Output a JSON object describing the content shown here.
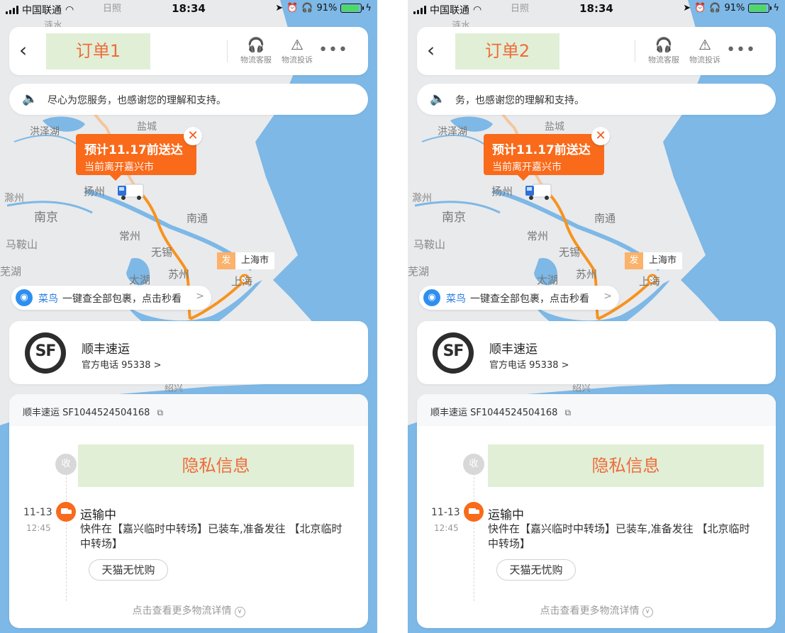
{
  "status_bar": {
    "carrier": "中国联通",
    "time": "18:34",
    "battery": "91%",
    "battery_level": 0.91
  },
  "colors": {
    "accent": "#f96a1a",
    "route": "#f7931e",
    "water": "#7db8e6",
    "land": "#e9eaec",
    "highlight_box": "#e1efd7"
  },
  "map_labels": {
    "rizhao": "日照",
    "lianshui": "涟水",
    "yancheng": "盐城",
    "hongzehu": "洪泽湖",
    "yangzhou": "扬州",
    "chuzhou": "滁州",
    "nanjing": "南京",
    "nantong": "南通",
    "changzhou": "常州",
    "maanshan": "马鞍山",
    "wuxi": "无锡",
    "wuhu": "芜湖",
    "taihu": "太湖",
    "suzhou": "苏州",
    "shanghai": "上海",
    "shaoxing": "绍兴"
  },
  "screens": [
    {
      "title": "订单1",
      "header": {
        "support_label": "物流客服",
        "support_icon": "headset-icon",
        "complaint_label": "物流投诉",
        "complaint_icon": "warning-icon",
        "more_label": "•••"
      },
      "notice": "尽心为您服务，也感谢您的理解和支持。",
      "eta": {
        "line1": "预计11.17前送达",
        "line2": "当前离开嘉兴市"
      },
      "origin": {
        "tag": "发",
        "city": "上海市"
      },
      "cainiao": {
        "brand": "菜鸟",
        "text": "一键查全部包裹，点击秒看",
        "arrow": ">"
      },
      "courier": {
        "name": "顺丰速运",
        "logo_text": "SF",
        "phone": "官方电话 95338 >"
      },
      "tracking": {
        "header": "顺丰速运 SF1044524504168",
        "recv_label": "收",
        "privacy_label": "隐私信息",
        "event": {
          "date": "11-13",
          "time": "12:45",
          "status": "运输中",
          "desc": "快件在【嘉兴临时中转场】已装车,准备发往 【北京临时中转场】",
          "tag": "天猫无忧购"
        },
        "more": "点击查看更多物流详情"
      }
    },
    {
      "title": "订单2",
      "header": {
        "support_label": "物流客服",
        "support_icon": "headset-icon",
        "complaint_label": "物流投诉",
        "complaint_icon": "warning-icon",
        "more_label": "•••"
      },
      "notice": "务，也感谢您的理解和支持。",
      "eta": {
        "line1": "预计11.17前送达",
        "line2": "当前离开嘉兴市"
      },
      "origin": {
        "tag": "发",
        "city": "上海市"
      },
      "cainiao": {
        "brand": "菜鸟",
        "text": "一键查全部包裹，点击秒看",
        "arrow": ">"
      },
      "courier": {
        "name": "顺丰速运",
        "logo_text": "SF",
        "phone": "官方电话 95338 >"
      },
      "tracking": {
        "header": "顺丰速运 SF1044524504168",
        "recv_label": "收",
        "privacy_label": "隐私信息",
        "event": {
          "date": "11-13",
          "time": "12:45",
          "status": "运输中",
          "desc": "快件在【嘉兴临时中转场】已装车,准备发往 【北京临时中转场】",
          "tag": "天猫无忧购"
        },
        "more": "点击查看更多物流详情"
      }
    }
  ]
}
